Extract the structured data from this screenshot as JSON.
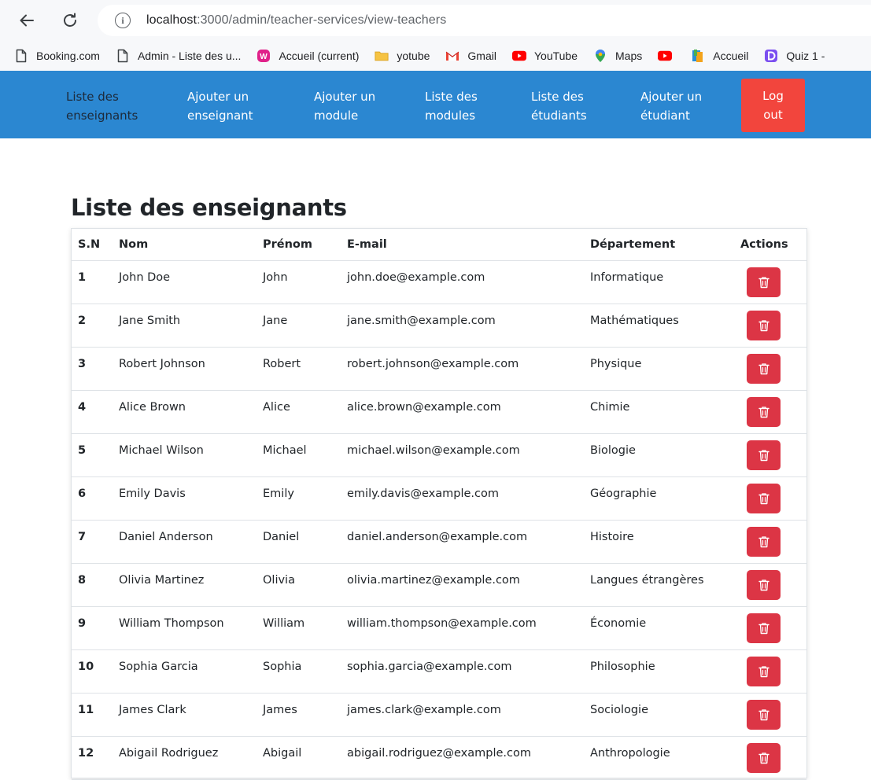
{
  "browser": {
    "url_host": "localhost",
    "url_path": ":3000/admin/teacher-services/view-teachers",
    "bookmarks": [
      {
        "label": "Booking.com",
        "icon": "page-icon"
      },
      {
        "label": "Admin - Liste des u...",
        "icon": "page-icon"
      },
      {
        "label": "Accueil (current)",
        "icon": "wamp-icon"
      },
      {
        "label": "yotube",
        "icon": "folder-icon"
      },
      {
        "label": "Gmail",
        "icon": "gmail-icon"
      },
      {
        "label": "YouTube",
        "icon": "youtube-icon"
      },
      {
        "label": "Maps",
        "icon": "maps-icon"
      },
      {
        "label": "",
        "icon": "youtube-icon"
      },
      {
        "label": "Accueil",
        "icon": "book-icon"
      },
      {
        "label": "Quiz 1 -",
        "icon": "quiz-icon"
      }
    ]
  },
  "navbar": {
    "links": [
      {
        "line1": "Liste des",
        "line2": "enseignants"
      },
      {
        "line1": "Ajouter un",
        "line2": "enseignant"
      },
      {
        "line1": "Ajouter un",
        "line2": "module"
      },
      {
        "line1": "Liste des",
        "line2": "modules"
      },
      {
        "line1": "Liste des",
        "line2": "étudiants"
      },
      {
        "line1": "Ajouter un",
        "line2": "étudiant"
      }
    ],
    "logout": {
      "line1": "Log",
      "line2": "out"
    }
  },
  "page": {
    "title": "Liste des enseignants"
  },
  "table": {
    "headers": [
      "S.N",
      "Nom",
      "Prénom",
      "E-mail",
      "Département",
      "Actions"
    ],
    "rows": [
      {
        "sn": "1",
        "nom": "John Doe",
        "prenom": "John",
        "email": "john.doe@example.com",
        "departement": "Informatique"
      },
      {
        "sn": "2",
        "nom": "Jane Smith",
        "prenom": "Jane",
        "email": "jane.smith@example.com",
        "departement": "Mathématiques"
      },
      {
        "sn": "3",
        "nom": "Robert Johnson",
        "prenom": "Robert",
        "email": "robert.johnson@example.com",
        "departement": "Physique"
      },
      {
        "sn": "4",
        "nom": "Alice Brown",
        "prenom": "Alice",
        "email": "alice.brown@example.com",
        "departement": "Chimie"
      },
      {
        "sn": "5",
        "nom": "Michael Wilson",
        "prenom": "Michael",
        "email": "michael.wilson@example.com",
        "departement": "Biologie"
      },
      {
        "sn": "6",
        "nom": "Emily Davis",
        "prenom": "Emily",
        "email": "emily.davis@example.com",
        "departement": "Géographie"
      },
      {
        "sn": "7",
        "nom": "Daniel Anderson",
        "prenom": "Daniel",
        "email": "daniel.anderson@example.com",
        "departement": "Histoire"
      },
      {
        "sn": "8",
        "nom": "Olivia Martinez",
        "prenom": "Olivia",
        "email": "olivia.martinez@example.com",
        "departement": "Langues étrangères"
      },
      {
        "sn": "9",
        "nom": "William Thompson",
        "prenom": "William",
        "email": "william.thompson@example.com",
        "departement": "Économie"
      },
      {
        "sn": "10",
        "nom": "Sophia Garcia",
        "prenom": "Sophia",
        "email": "sophia.garcia@example.com",
        "departement": "Philosophie"
      },
      {
        "sn": "11",
        "nom": "James Clark",
        "prenom": "James",
        "email": "james.clark@example.com",
        "departement": "Sociologie"
      },
      {
        "sn": "12",
        "nom": "Abigail Rodriguez",
        "prenom": "Abigail",
        "email": "abigail.rodriguez@example.com",
        "departement": "Anthropologie"
      }
    ],
    "delete_icon": "trash-icon"
  },
  "colors": {
    "navbar": "#2b87d1",
    "logout": "#f2453d",
    "delete": "#dc3545"
  }
}
